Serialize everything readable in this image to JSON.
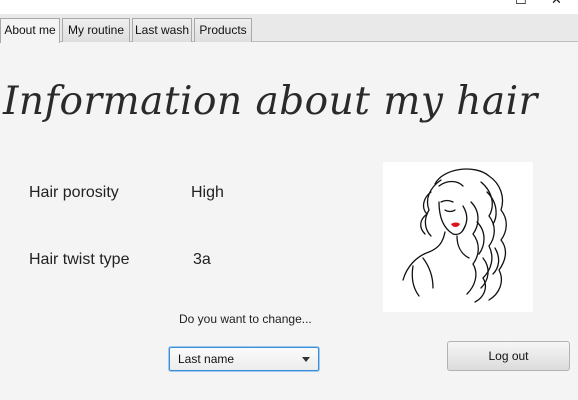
{
  "window": {
    "maximize_glyph": "☐",
    "close_glyph": "✕"
  },
  "tabs": [
    {
      "label": "About me",
      "active": true
    },
    {
      "label": "My routine",
      "active": false
    },
    {
      "label": "Last wash",
      "active": false
    },
    {
      "label": "Products",
      "active": false
    }
  ],
  "main": {
    "heading": "Information about my hair",
    "porosity_label": "Hair porosity",
    "porosity_value": "High",
    "twist_label": "Hair twist type",
    "twist_value": "3a",
    "change_prompt": "Do you want to change...",
    "change_select_value": "Last name",
    "logout_label": "Log out"
  },
  "colors": {
    "accent_focus": "#3a8fd6",
    "lips": "#e0101e"
  },
  "icons": {
    "illustration": "woman-long-wavy-hair-illustration"
  }
}
